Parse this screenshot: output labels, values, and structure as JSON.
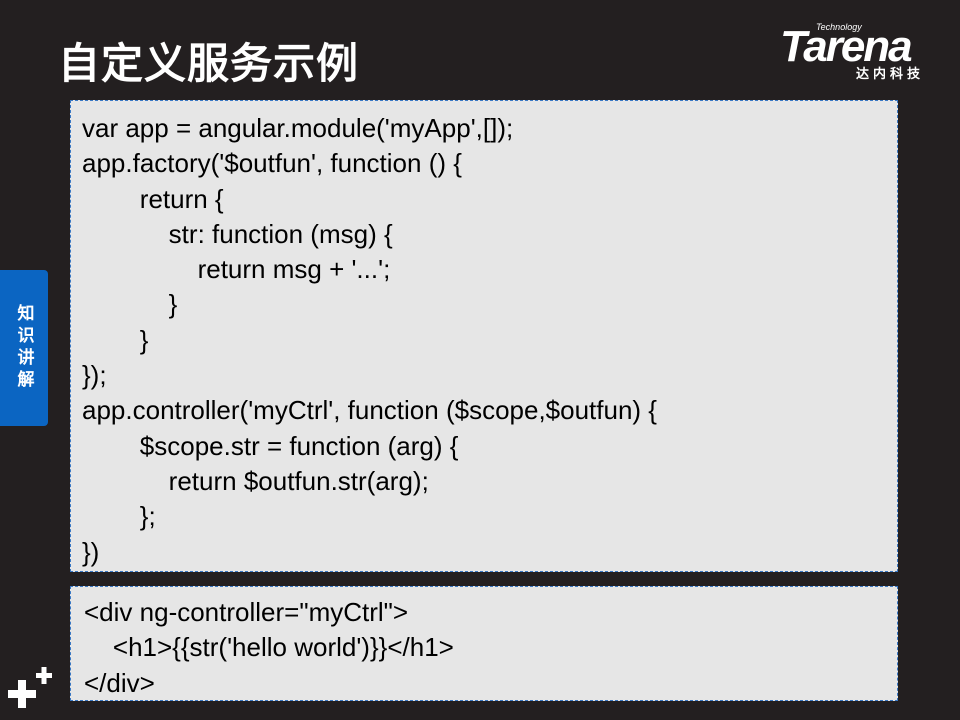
{
  "slide": {
    "title": "自定义服务示例",
    "side_tab": "知识讲解"
  },
  "brand": {
    "tech_label": "Technology",
    "name": "Tarena",
    "cn_name": "达内科技"
  },
  "code_block_1": {
    "lines": [
      "var app = angular.module('myApp',[]);",
      "app.factory('$outfun', function () {",
      "        return {",
      "            str: function (msg) {",
      "                return msg + '...';",
      "            }",
      "        }",
      "});",
      "app.controller('myCtrl', function ($scope,$outfun) {",
      "        $scope.str = function (arg) {",
      "            return $outfun.str(arg);",
      "        };",
      "})"
    ]
  },
  "code_block_2": {
    "lines": [
      "<div ng-controller=\"myCtrl\">",
      "    <h1>{{str('hello world')}}</h1>",
      "</div>"
    ]
  },
  "colors": {
    "background": "#231f20",
    "accent_blue": "#0b65c2",
    "code_bg": "#e6e6e6",
    "code_border": "#3a78c4"
  },
  "icons": {
    "bottom_left": "plus-plus-logo-icon"
  }
}
